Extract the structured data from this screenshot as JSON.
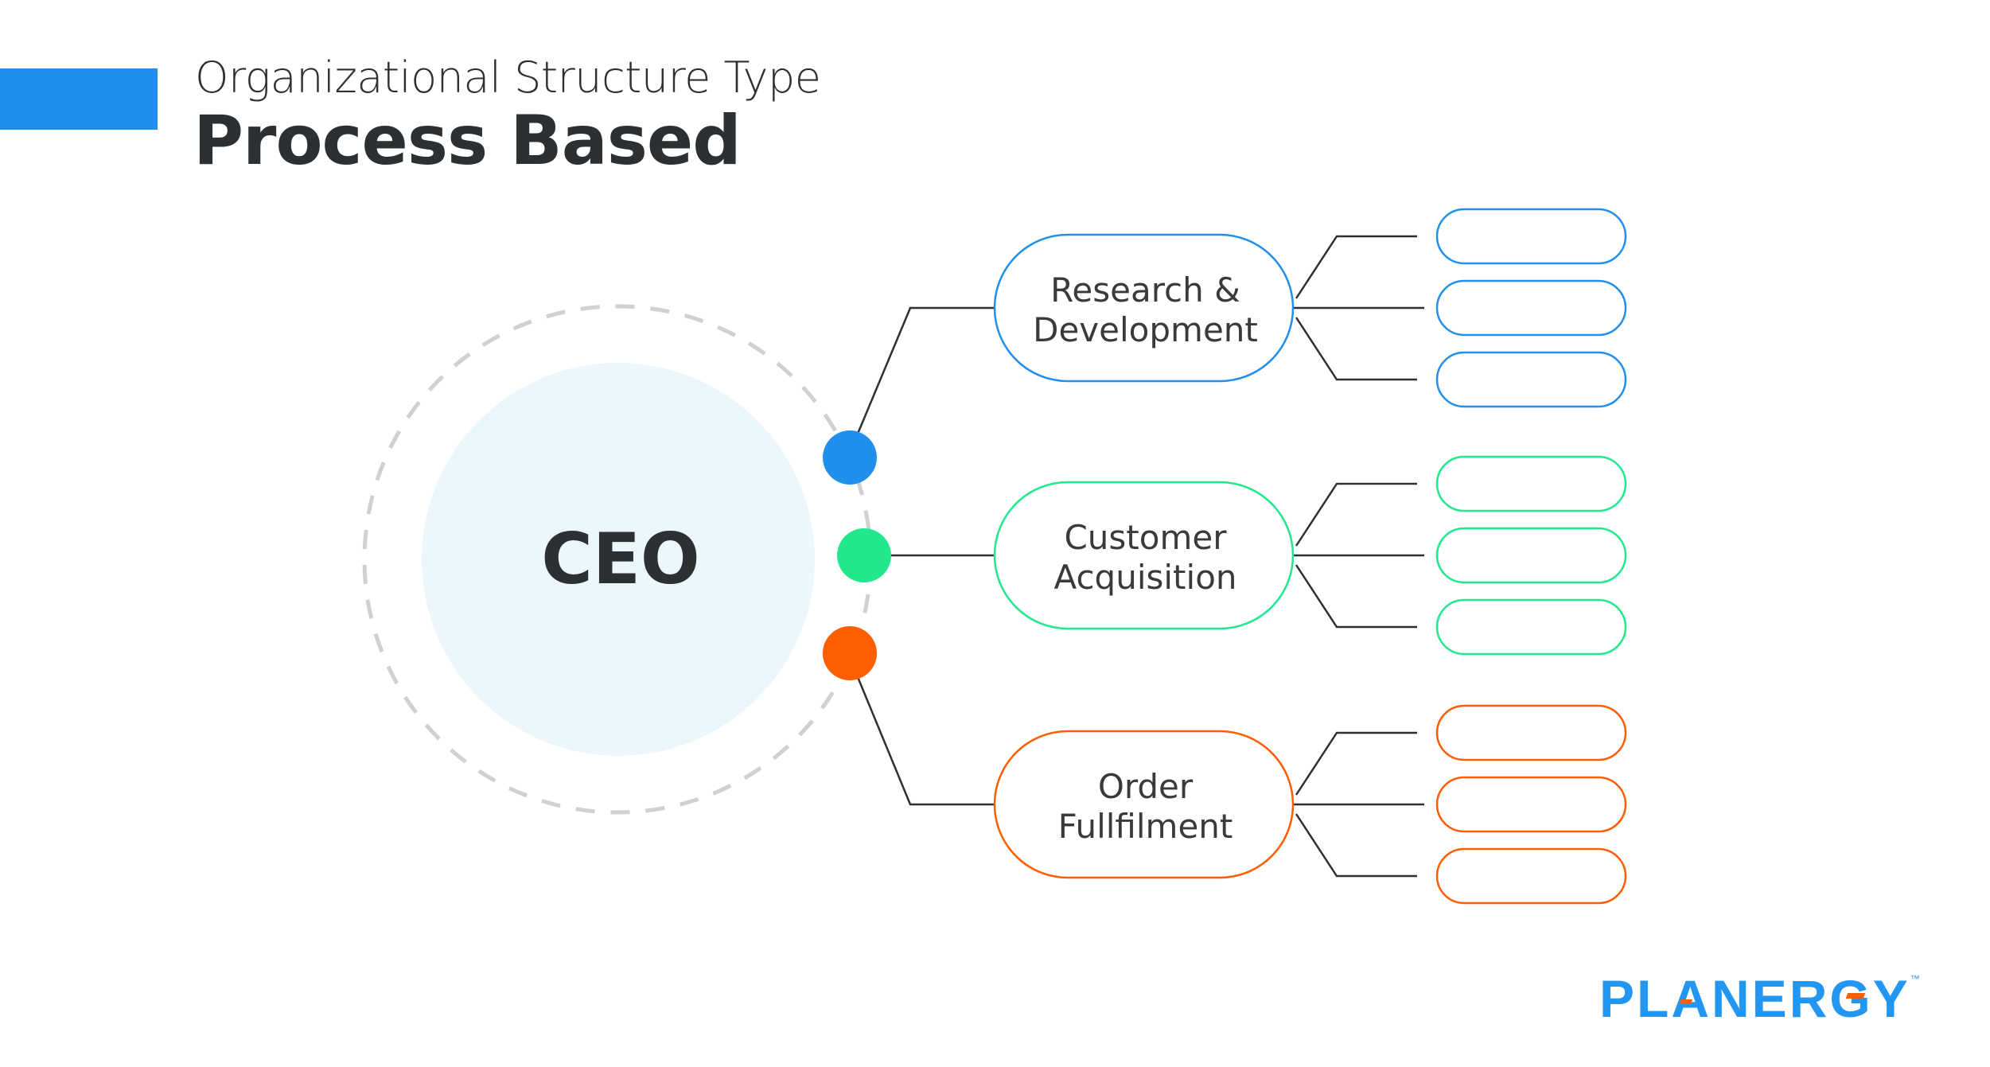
{
  "header": {
    "subtitle": "Organizational Structure Type",
    "title": "Process Based",
    "accent_color": "#1f8eec"
  },
  "root": {
    "label": "CEO",
    "fill_color": "#ebf6fd",
    "ring_color": "#d0d0d0"
  },
  "departments": [
    {
      "line1": "Research &",
      "line2": "Development",
      "color": "#2090ec",
      "sub_items": [
        "",
        "",
        ""
      ]
    },
    {
      "line1": "Customer",
      "line2": "Acquisition",
      "color": "#22e88d",
      "sub_items": [
        "",
        "",
        ""
      ]
    },
    {
      "line1": "Order",
      "line2": "Fullfilment",
      "color": "#ff5e00",
      "sub_items": [
        "",
        "",
        ""
      ]
    }
  ],
  "connector_color": "#2c3033",
  "logo": {
    "letters": [
      "PL",
      "A",
      "NER",
      "G",
      "Y"
    ],
    "trademark": "™",
    "color": "#2196f3",
    "accent_color": "#ff5e00"
  }
}
